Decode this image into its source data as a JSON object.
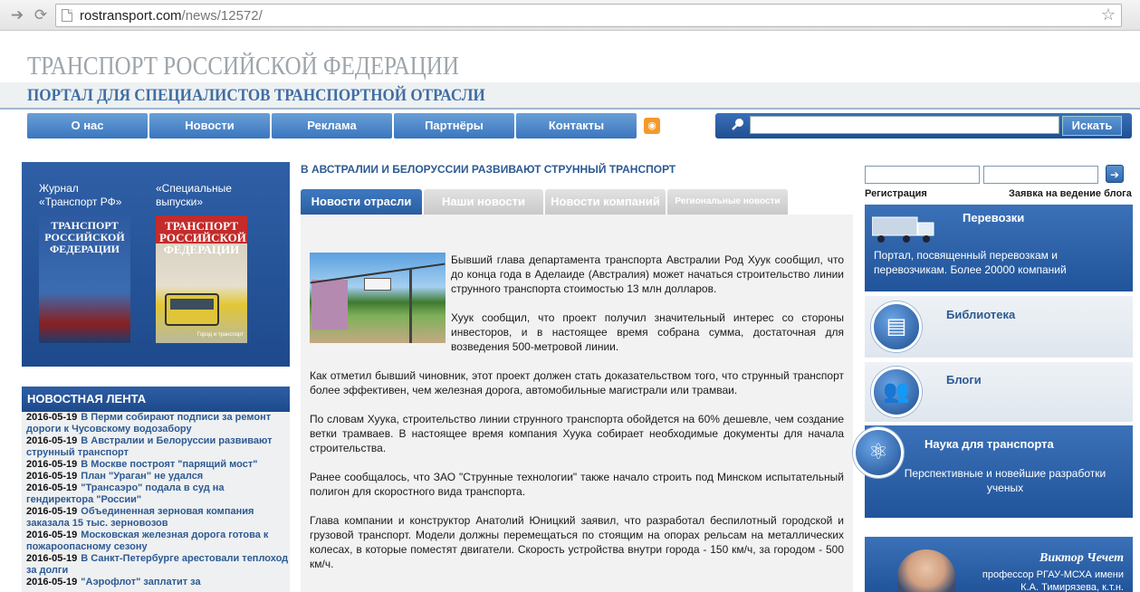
{
  "browser": {
    "url_domain": "rostransport.com",
    "url_path": "/news/12572/"
  },
  "header": {
    "title": "ТРАНСПОРТ РОССИЙСКОЙ ФЕДЕРАЦИИ",
    "subtitle": "ПОРТАЛ ДЛЯ СПЕЦИАЛИСТОВ ТРАНСПОРТНОЙ ОТРАСЛИ"
  },
  "menu": {
    "items": [
      "О нас",
      "Новости",
      "Реклама",
      "Партнёры",
      "Контакты"
    ]
  },
  "search": {
    "button": "Искать",
    "value": ""
  },
  "magazines": {
    "mag1_label": "Журнал «Транспорт РФ»",
    "mag2_label": "«Специальные выпуски»",
    "cover1_title": "ТРАНСПОРТ РОССИЙСКОЙ ФЕДЕРАЦИИ",
    "cover2_title": "ТРАНСПОРТ РОССИЙСКОЙ ФЕДЕРАЦИИ",
    "cover2_foot": "Город и транспорт"
  },
  "newsfeed": {
    "title": "НОВОСТНАЯ ЛЕНТА",
    "items": [
      {
        "date": "2016-05-19",
        "text": "В Перми собирают подписи за ремонт дороги к Чусовскому водозабору"
      },
      {
        "date": "2016-05-19",
        "text": "В Австралии и Белоруссии развивают струнный транспорт"
      },
      {
        "date": "2016-05-19",
        "text": "В Москве построят \"парящий мост\""
      },
      {
        "date": "2016-05-19",
        "text": "План \"Ураган\" не удался"
      },
      {
        "date": "2016-05-19",
        "text": "\"Трансаэро\" подала в суд на гендиректора \"России\""
      },
      {
        "date": "2016-05-19",
        "text": "Объединенная зерновая компания заказала 15 тыс. зерновозов"
      },
      {
        "date": "2016-05-19",
        "text": "Московская железная дорога готова к пожароопасному сезону"
      },
      {
        "date": "2016-05-19",
        "text": "В Санкт-Петербурге арестовали теплоход за долги"
      },
      {
        "date": "2016-05-19",
        "text": "\"Аэрофлот\" заплатит за"
      }
    ]
  },
  "article": {
    "title": "В АВСТРАЛИИ И БЕЛОРУССИИ РАЗВИВАЮТ СТРУННЫЙ ТРАНСПОРТ",
    "tabs": [
      "Новости отрасли",
      "Наши новости",
      "Новости компаний",
      "Региональные новости"
    ],
    "paragraphs": [
      "Бывший глава департамента транспорта Австралии Род Хуук сообщил, что до конца года в Аделаиде (Австралия) может начаться строительство линии струнного транспорта стоимостью 13 млн долларов.",
      "Хуук сообщил, что проект получил значительный интерес со стороны инвесторов, и в настоящее время собрана сумма, достаточная для возведения 500-метровой линии.",
      "Как отметил бывший чиновник, этот проект должен стать доказательством того, что струнный транспорт более эффективен, чем железная дорога, автомобильные магистрали или трамваи.",
      "По словам Хуука, строительство линии струнного транспорта обойдется на 60% дешевле, чем создание ветки трамваев. В настоящее время компания Хуука собирает необходимые документы для начала строительства.",
      "Ранее сообщалось, что ЗАО \"Струнные технологии\" также начало строить под Минском испытательный полигон для скоростного вида транспорта.",
      "Глава компании и конструктор Анатолий Юницкий заявил, что разработал беспилотный городской и грузовой транспорт. Модели должны перемещаться по стоящим на опорах рельсам на металлических колесах, в которые поместят двигатели. Скорость устройства внутри города - 150 км/ч, за городом - 500 км/ч."
    ]
  },
  "sidebar": {
    "register": "Регистрация",
    "blog_request": "Заявка на ведение блога",
    "perevozki_title": "Перевозки",
    "perevozki_text": "Портал, посвященный перевозкам и перевозчикам. Более 20000 компаний",
    "library": "Библиотека",
    "blogs": "Блоги",
    "science_title": "Наука для транспорта",
    "science_text": "Перспективные и новейшие разработки ученых",
    "profile_name": "Виктор Чечет",
    "profile_desc_1": "профессор РГАУ-МСХА имени",
    "profile_desc_2": "К.А. Тимирязева, к.т.н."
  }
}
